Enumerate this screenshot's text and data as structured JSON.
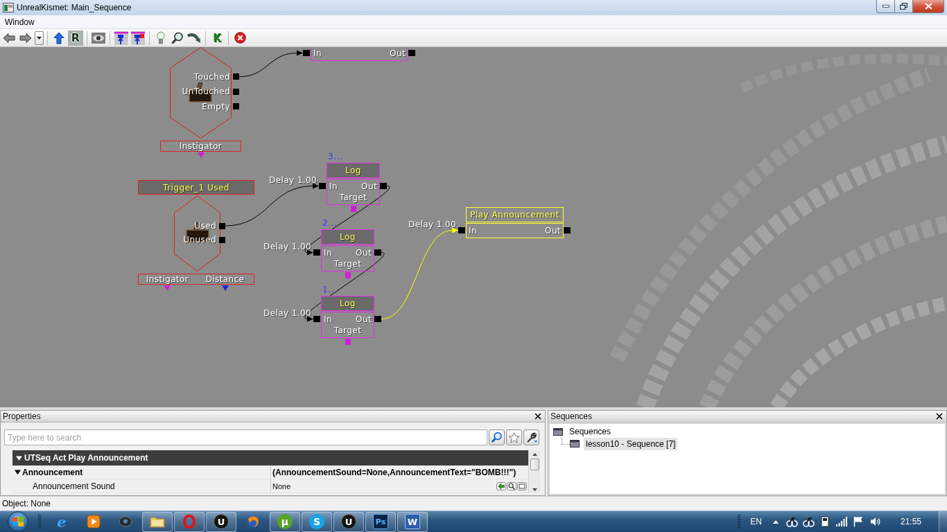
{
  "window": {
    "title": "UnrealKismet: Main_Sequence"
  },
  "menu": [
    "Window"
  ],
  "toolbar": {
    "glyph_buttons": [
      "R",
      "K"
    ]
  },
  "canvas": {
    "events": [
      {
        "outputs": [
          "Touched",
          "UnTouched",
          "Empty"
        ],
        "variables": [
          {
            "label": "Instigator",
            "color": "#d41cd4"
          }
        ]
      },
      {
        "title": "Trigger_1 Used",
        "outputs": [
          "Used",
          "Unused"
        ],
        "variables": [
          {
            "label": "Instigator",
            "color": "#d41cd4"
          },
          {
            "label": "Distance",
            "color": "#2323d6"
          }
        ]
      }
    ],
    "actions": [
      {
        "inputs": [
          "In"
        ],
        "outputs": [
          "Out"
        ],
        "selected": false
      },
      {
        "comment": "3...",
        "title": "Log",
        "delay": "Delay 1.00",
        "inputs": [
          "In"
        ],
        "outputs": [
          "Out"
        ],
        "variables": [
          {
            "label": "Target",
            "color": "#d41cd4"
          }
        ],
        "selected": false
      },
      {
        "comment": "2...",
        "title": "Log",
        "delay": "Delay 1.00",
        "inputs": [
          "In"
        ],
        "outputs": [
          "Out"
        ],
        "variables": [
          {
            "label": "Target",
            "color": "#d41cd4"
          }
        ],
        "selected": false
      },
      {
        "comment": "1...",
        "title": "Log",
        "delay": "Delay 1.00",
        "inputs": [
          "In"
        ],
        "outputs": [
          "Out"
        ],
        "variables": [
          {
            "label": "Target",
            "color": "#d41cd4"
          }
        ],
        "selected": false
      },
      {
        "title": "Play Announcement",
        "delay": "Delay 1.00",
        "inputs": [
          "In"
        ],
        "outputs": [
          "Out"
        ],
        "selected": true
      }
    ]
  },
  "properties_panel": {
    "title": "Properties",
    "search": {
      "placeholder": "Type here to search"
    },
    "category": {
      "label": "UTSeq Act Play Announcement",
      "expanded": true,
      "children": [
        {
          "name": "Announcement",
          "value": "(AnnouncementSound=None,AnnouncementText=\"BOMB!!!\")",
          "expanded": true,
          "children": [
            {
              "name": "Announcement Sound",
              "value": "None"
            }
          ]
        }
      ]
    }
  },
  "sequences_panel": {
    "title": "Sequences",
    "tree": [
      {
        "label": "Sequences",
        "selected": false,
        "children": [
          {
            "label": "lesson10 - Sequence [7]",
            "selected": true
          }
        ]
      }
    ]
  },
  "status_bar": {
    "text": "Object: None"
  },
  "taskbar": {
    "apps": [
      {
        "glyph": "e",
        "running": false
      },
      {
        "running": false
      },
      {
        "running": false
      },
      {
        "running": true
      },
      {
        "running": true
      },
      {
        "glyph": "U",
        "running": true
      },
      {
        "running": false
      },
      {
        "glyph": "µ",
        "running": true
      },
      {
        "glyph": "S",
        "running": true
      },
      {
        "glyph": "U",
        "running": true
      },
      {
        "glyph": "Ps",
        "running": true
      },
      {
        "glyph": "W",
        "running": true
      }
    ],
    "language": "EN",
    "clock": "21:55"
  }
}
